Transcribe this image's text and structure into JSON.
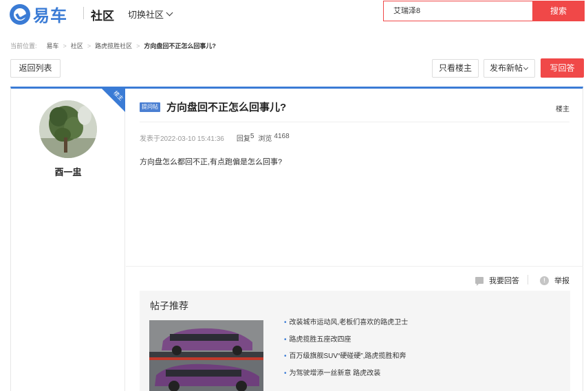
{
  "header": {
    "logo_text": "易车",
    "community_title": "社区",
    "switch_label": "切换社区",
    "search_value": "艾瑞泽8",
    "search_button": "搜索"
  },
  "breadcrumb": {
    "prefix": "当前位置:",
    "items": [
      "易车",
      "社区",
      "路虎揽胜社区"
    ],
    "current": "方向盘回不正怎么回事儿?"
  },
  "actions": {
    "back": "返回列表",
    "only_owner": "只看楼主",
    "new_post": "发布新帖",
    "reply": "写回答"
  },
  "author": {
    "ribbon": "楼主",
    "name": "酉一盅"
  },
  "post": {
    "tag": "提问帖",
    "title": "方向盘回不正怎么回事儿?",
    "floor": "楼主",
    "posted_at": "发表于2022-03-10 15:41:36",
    "replies_label": "回复",
    "replies": "5",
    "views_label": "浏览",
    "views": "4168",
    "body": "方向盘怎么都回不正,有点跑偏是怎么回事?"
  },
  "footer": {
    "answer": "我要回答",
    "report": "举报"
  },
  "recommend": {
    "title": "帖子推荐",
    "items": [
      "改装城市运动风,老板们喜欢的路虎卫士",
      "路虎揽胜五座改四座",
      "百万级旗舰SUV“硬碰硬”,路虎揽胜和奔",
      "为驾驶增添一丝新意 路虎改装"
    ]
  },
  "colors": {
    "brand_blue": "#3a7bd5",
    "accent_red": "#f04848"
  }
}
